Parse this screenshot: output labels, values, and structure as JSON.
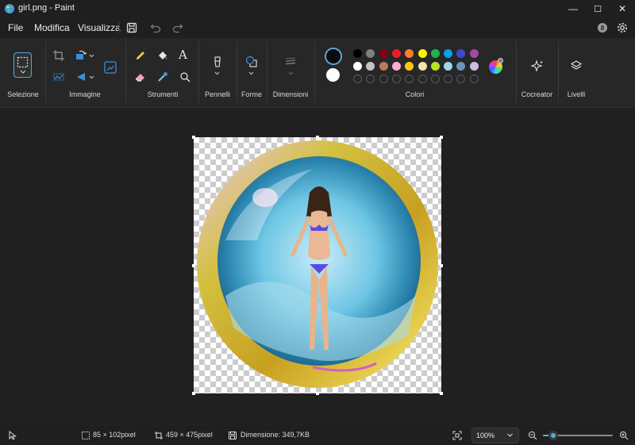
{
  "window": {
    "title": "girl.png - Paint",
    "minimize_glyph": "—",
    "maximize_glyph": "☐",
    "close_glyph": "✕"
  },
  "menu": {
    "file": "File",
    "edit": "Modifica",
    "view": "Visualizza"
  },
  "ribbon": {
    "groups": {
      "selection": "Selezione",
      "image": "Immagine",
      "tools": "Strumenti",
      "brushes": "Pennelli",
      "shapes": "Forme",
      "size": "Dimensioni",
      "colors": "Colori",
      "cocreator": "Cocreator",
      "layers": "Livelli"
    },
    "text_tool_glyph": "A",
    "color1": "#0c0c0c",
    "color2": "#ffffff",
    "palette_row1": [
      "#000000",
      "#7f7f7f",
      "#880015",
      "#ed1c24",
      "#ff7f27",
      "#fff200",
      "#22b14c",
      "#00a2e8",
      "#3f48cc",
      "#a349a4"
    ],
    "palette_row2": [
      "#ffffff",
      "#c3c3c3",
      "#b97a57",
      "#ffaec9",
      "#ffc90e",
      "#efe4b0",
      "#b5e61d",
      "#99d9ea",
      "#7092be",
      "#c8bfe7"
    ],
    "accent": "#5aa8d8"
  },
  "status": {
    "selection_size": "85 × 102pixel",
    "canvas_size": "459 × 475pixel",
    "file_size": "Dimensione: 349,7KB",
    "zoom": "100%",
    "zoom_fraction": 0.15
  },
  "canvas": {
    "icon_names": [
      "pointer-icon",
      "selection-size-icon",
      "canvas-size-icon",
      "save-icon",
      "fit-icon",
      "zoom-out-icon",
      "zoom-in-icon"
    ]
  }
}
